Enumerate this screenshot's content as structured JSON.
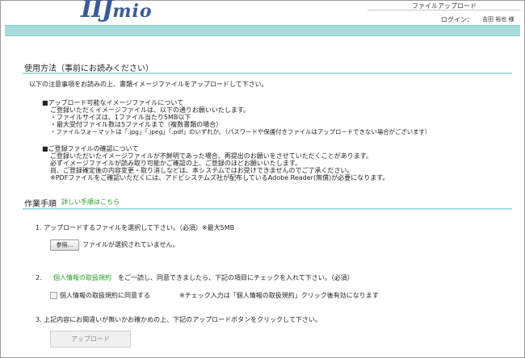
{
  "header": {
    "logo_main": "IIJ",
    "logo_sub": "mio",
    "page_title": "ファイルアップロード",
    "login_label": "ログイン：",
    "login_name": "吉田 裕也 様"
  },
  "usage": {
    "title": "使用方法（事前にお読みください）",
    "intro": "以下の注意事項をお読みの上、書類イメージファイルをアップロードして下さい。",
    "block1": {
      "heading": "■アップロード可能なイメージファイルについて",
      "lines": [
        "ご登録いただくイメージファイルは、以下の通りお願いいたします。",
        "・ファイルサイズは、1ファイル当たり5MB以下",
        "・最大受付ファイル数は5ファイルまで（複数書類の場合）",
        "・ファイルフォーマットは「.jpg」「.jpeg」「.pdf」のいずれか。（パスワードや保護付きファイルはアップロードできない場合がございます）"
      ]
    },
    "block2": {
      "heading": "■ご登録ファイルの確認について",
      "lines": [
        "ご登録いただいたイメージファイルが不鮮明であった場合、再提出のお願いをさせていただくことがあります。",
        "必ずイメージファイルが読み取り可能かご確認の上、ご登録のほどお願いいたします。",
        "尚、ご登録確定後の内容変更・取り消しなどは、本システムではお受けできませんのでご了承ください。",
        "※PDFファイルをご確認いただくには、アドビシステムズ社が配布しているAdobe Reader(無償)が必要になります。"
      ]
    }
  },
  "steps": {
    "title": "作業手順",
    "detail_link": "詳しい手順はこちら",
    "step1": {
      "text": "1.  アップロードするファイルを選択して下さい。（必須）※最大5MB",
      "browse_label": "参照...",
      "no_file": "ファイルが選択されていません。"
    },
    "step2": {
      "number": "2.",
      "policy_link": "個人情報の取扱規約",
      "text": "をご一読し、同意できましたら、下記の項目にチェックを入れて下さい。（必須）",
      "checkbox_label": "個人情報の取扱規約に同意する",
      "note": "※チェック入力は「個人情報の取扱規約」クリック後有効になります"
    },
    "step3": {
      "text": "3.  上記内容にお間違いが無いかお確かめの上、下記のアップロードボタンをクリックして下さい。",
      "upload_label": "アップロード"
    }
  },
  "colors": {
    "accent_band": "#a8dcdc",
    "link_green": "#2a9d2a",
    "logo_blue": "#3a5a9c"
  }
}
